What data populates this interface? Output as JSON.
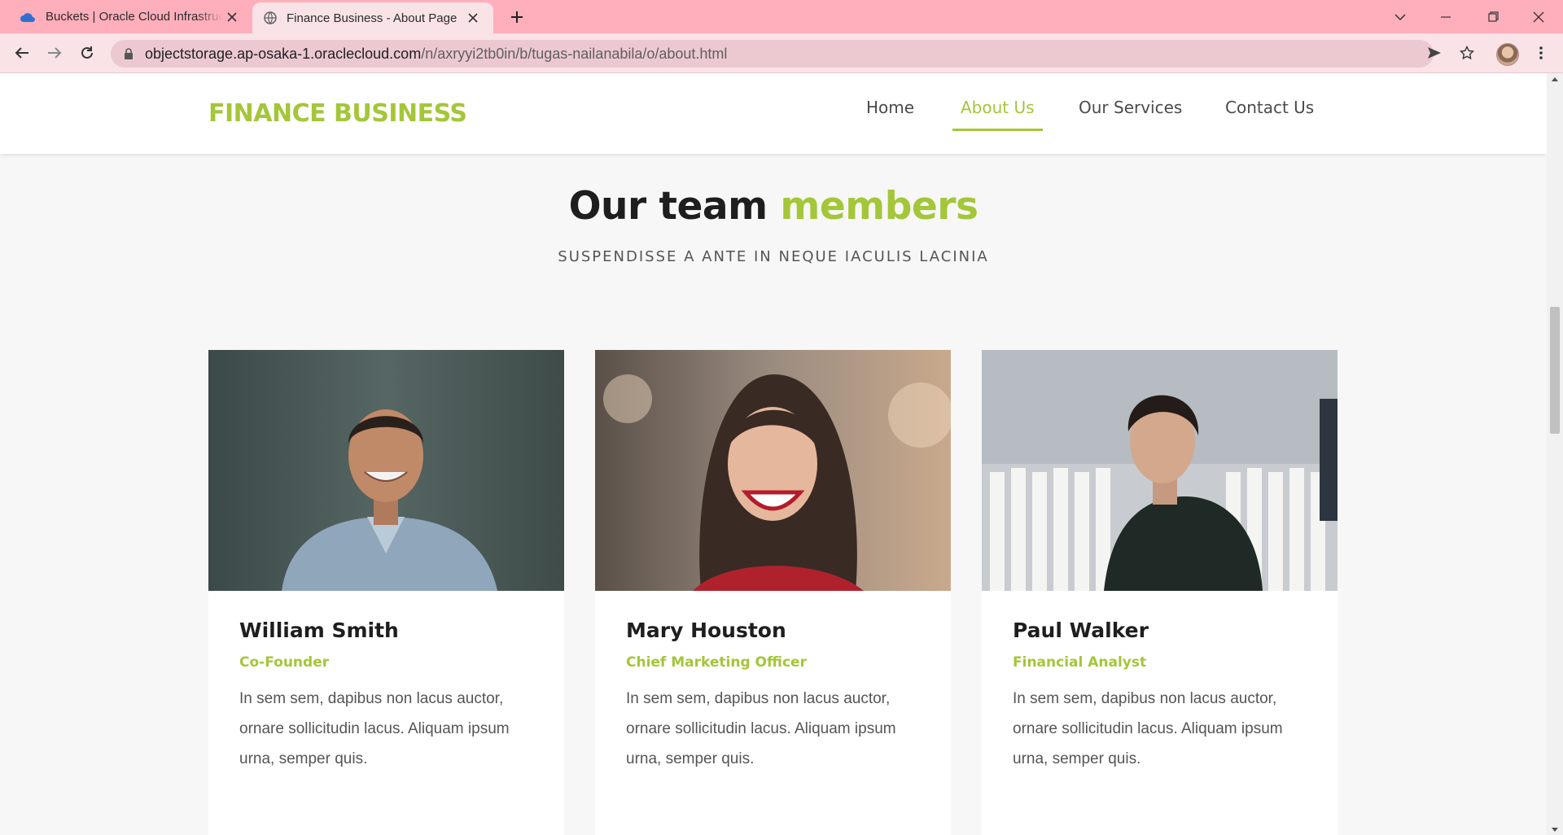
{
  "browser": {
    "tabs": [
      {
        "title": "Buckets | Oracle Cloud Infrastructure",
        "icon": "cloud-icon"
      },
      {
        "title": "Finance Business - About Page",
        "icon": "globe-icon"
      }
    ],
    "url_host": "objectstorage.ap-osaka-1.oraclecloud.com",
    "url_path": "/n/axryyi2tb0in/b/tugas-nailanabila/o/about.html"
  },
  "site": {
    "logo": "FINANCE BUSINESS",
    "nav": [
      {
        "label": "Home"
      },
      {
        "label": "About Us"
      },
      {
        "label": "Our Services"
      },
      {
        "label": "Contact Us"
      }
    ],
    "active_nav": "About Us"
  },
  "team": {
    "title_main": "Our team ",
    "title_accent": "members",
    "subtitle": "SUSPENDISSE A ANTE IN NEQUE IACULIS LACINIA",
    "members": [
      {
        "name": "William Smith",
        "role": "Co-Founder",
        "bio": "In sem sem, dapibus non lacus auctor, ornare sollicitudin lacus. Aliquam ipsum urna, semper quis."
      },
      {
        "name": "Mary Houston",
        "role": "Chief Marketing Officer",
        "bio": "In sem sem, dapibus non lacus auctor, ornare sollicitudin lacus. Aliquam ipsum urna, semper quis."
      },
      {
        "name": "Paul Walker",
        "role": "Financial Analyst",
        "bio": "In sem sem, dapibus non lacus auctor, ornare sollicitudin lacus. Aliquam ipsum urna, semper quis."
      }
    ]
  },
  "colors": {
    "accent": "#a4c639",
    "tabbar": "#ffaebc",
    "toolbar": "#f9e3e7"
  }
}
